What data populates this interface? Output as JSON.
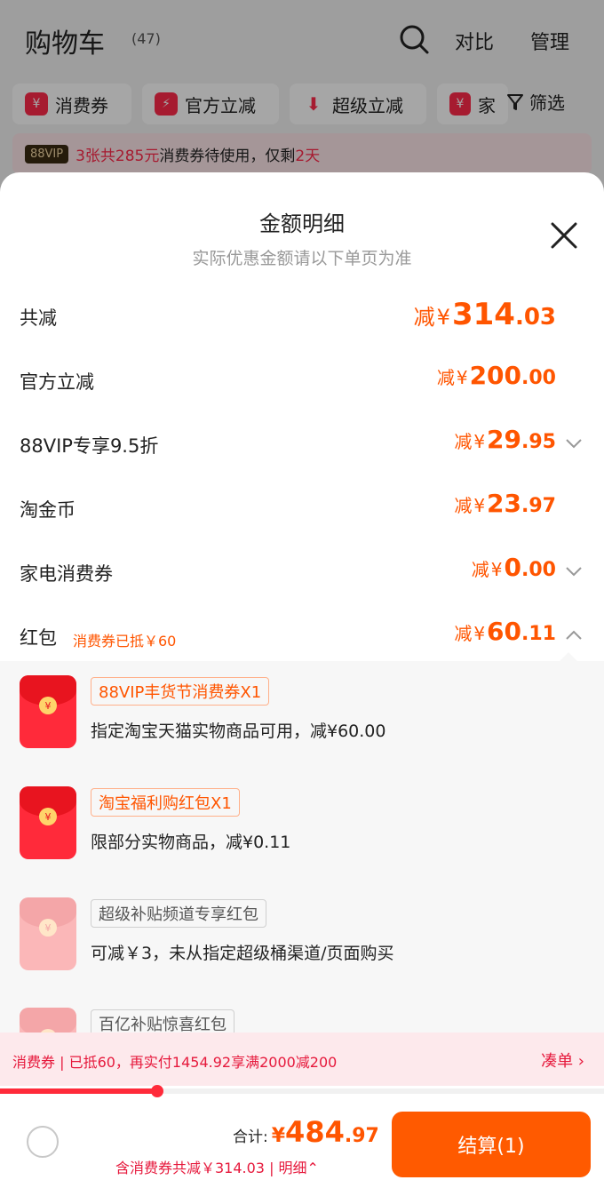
{
  "header": {
    "title": "购物车",
    "count": "(47)",
    "compare": "对比",
    "manage": "管理"
  },
  "chips": [
    {
      "icon": "¥",
      "label": "消费券"
    },
    {
      "icon": "⚡",
      "label": "官方立减"
    },
    {
      "icon": "⬇",
      "label": "超级立减"
    },
    {
      "icon": "¥",
      "label": "家"
    }
  ],
  "filter_label": "筛选",
  "notice": {
    "badge": "88VIP",
    "part1": "3张共285元",
    "part2": "消费券待使用，仅剩",
    "part3": "2天"
  },
  "sheet": {
    "title": "金额明细",
    "subtitle": "实际优惠金额请以下单页为准",
    "rows": [
      {
        "label": "共减",
        "prefix": "减",
        "yen": "¥",
        "int": "314",
        "dec": ".03"
      },
      {
        "label": "官方立减",
        "prefix": "减",
        "yen": "¥",
        "int": "200",
        "dec": ".00"
      },
      {
        "label": "88VIP专享9.5折",
        "prefix": "减",
        "yen": "¥",
        "int": "29",
        "dec": ".95"
      },
      {
        "label": "淘金币",
        "prefix": "减",
        "yen": "¥",
        "int": "23",
        "dec": ".97"
      },
      {
        "label": "家电消费券",
        "prefix": "减",
        "yen": "¥",
        "int": "0",
        "dec": ".00"
      },
      {
        "label": "红包",
        "sublabel": "消费券已抵￥60",
        "prefix": "减",
        "yen": "¥",
        "int": "60",
        "dec": ".11"
      }
    ],
    "packets": [
      {
        "tag": "88VIP丰货节消费券X1",
        "desc": "指定淘宝天猫实物商品可用，减¥60.00"
      },
      {
        "tag": "淘宝福利购红包X1",
        "desc": "限部分实物商品，减¥0.11"
      },
      {
        "tag": "超级补贴频道专享红包",
        "desc": "可减￥3，未从指定超级桶渠道/页面购买"
      },
      {
        "tag": "百亿补贴惊喜红包",
        "desc": ""
      }
    ]
  },
  "promo": {
    "text": "消费券 | 已抵60，再实付1454.92享满2000减200",
    "link": "凑单 ›",
    "progress": 0.26
  },
  "footer": {
    "total_label": "合计:",
    "yen": "¥",
    "total_int": "484",
    "total_dec": ".97",
    "saved_text": "含消费券共减￥314.03 | 明细⌃",
    "checkout": "结算(1)"
  }
}
